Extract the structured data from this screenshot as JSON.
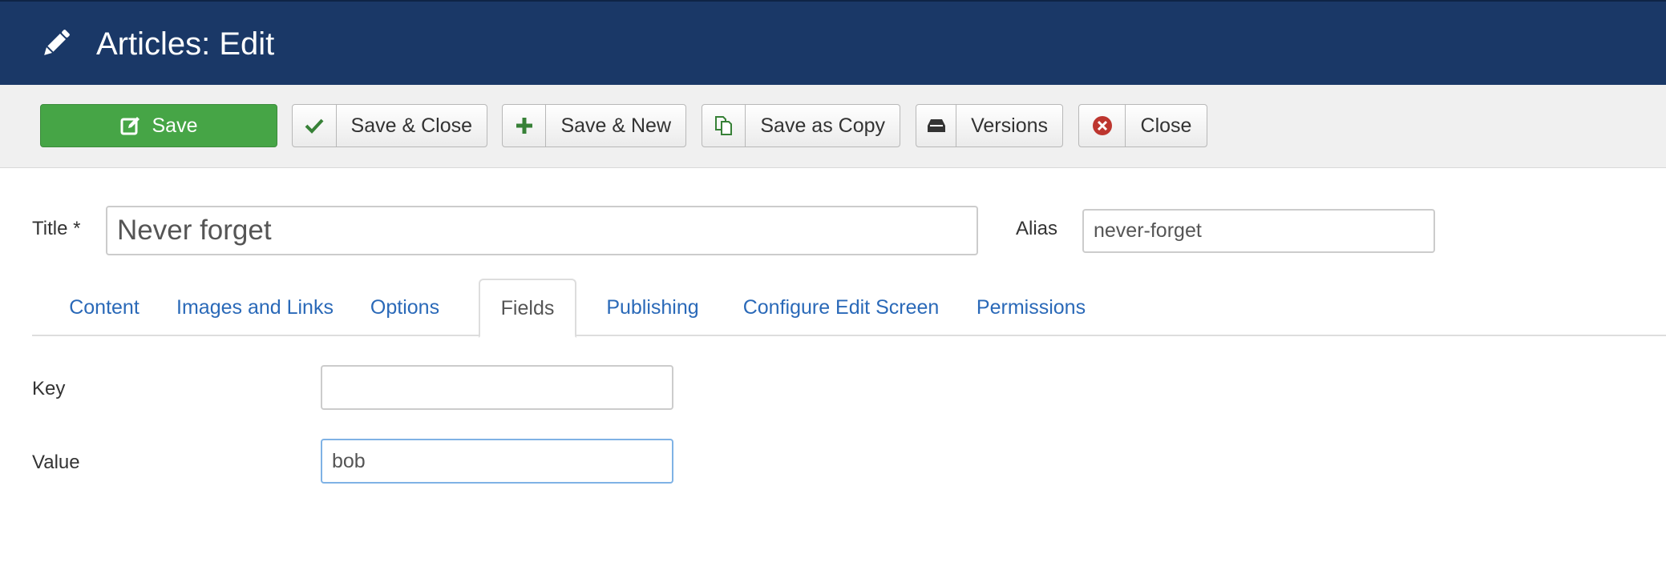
{
  "header": {
    "title": "Articles: Edit",
    "icon": "pencil-icon",
    "background": "#1a3867"
  },
  "toolbar": {
    "save": "Save",
    "save_close": "Save & Close",
    "save_new": "Save & New",
    "save_copy": "Save as Copy",
    "versions": "Versions",
    "close": "Close",
    "save_color": "#46a546"
  },
  "form": {
    "title_label": "Title *",
    "title_value": "Never forget",
    "alias_label": "Alias",
    "alias_value": "never-forget"
  },
  "tabs": [
    {
      "label": "Content",
      "active": false
    },
    {
      "label": "Images and Links",
      "active": false
    },
    {
      "label": "Options",
      "active": false
    },
    {
      "label": "Fields",
      "active": true
    },
    {
      "label": "Publishing",
      "active": false
    },
    {
      "label": "Configure Edit Screen",
      "active": false
    },
    {
      "label": "Permissions",
      "active": false
    }
  ],
  "fields": {
    "key_label": "Key",
    "key_value": "",
    "value_label": "Value",
    "value_value": "bob"
  }
}
